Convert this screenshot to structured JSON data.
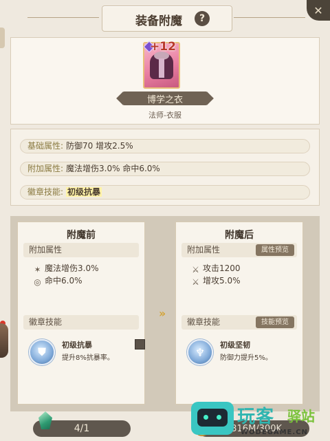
{
  "header": {
    "title": "装备附魔",
    "help": "?"
  },
  "item": {
    "enhance_level": "+12",
    "name": "博学之衣",
    "subtitle": "法师-衣服"
  },
  "attributes": {
    "base_label": "基础属性:",
    "base_value": "防御70  增攻2.5%",
    "extra_label": "附加属性:",
    "extra_value": "魔法增伤3.0%  命中6.0%",
    "badge_label": "徽章技能:",
    "badge_value": "初级抗暴"
  },
  "before": {
    "title": "附魔前",
    "extra_head": "附加属性",
    "stats": [
      {
        "icon": "magic-damage-icon",
        "text": "魔法增伤3.0%"
      },
      {
        "icon": "accuracy-icon",
        "text": "命中6.0%"
      }
    ],
    "badge_head": "徽章技能",
    "skill_name": "初级抗暴",
    "skill_desc": "提升8%抗暴率。"
  },
  "after": {
    "title": "附魔后",
    "extra_head": "附加属性",
    "extra_tag": "属性预览",
    "stats": [
      {
        "icon": "attack-icon",
        "text": "攻击1200"
      },
      {
        "icon": "attack-boost-icon",
        "text": "增攻5.0%"
      }
    ],
    "badge_head": "徽章技能",
    "badge_tag": "技能预览",
    "skill_name": "初级坚韧",
    "skill_desc": "防御力提升5%。"
  },
  "bottom": {
    "count": "4/1",
    "resource": "2316M/300K"
  },
  "watermark": {
    "main": "玩客",
    "secondary": "驿站",
    "sub": "WODEGAME.CN"
  }
}
